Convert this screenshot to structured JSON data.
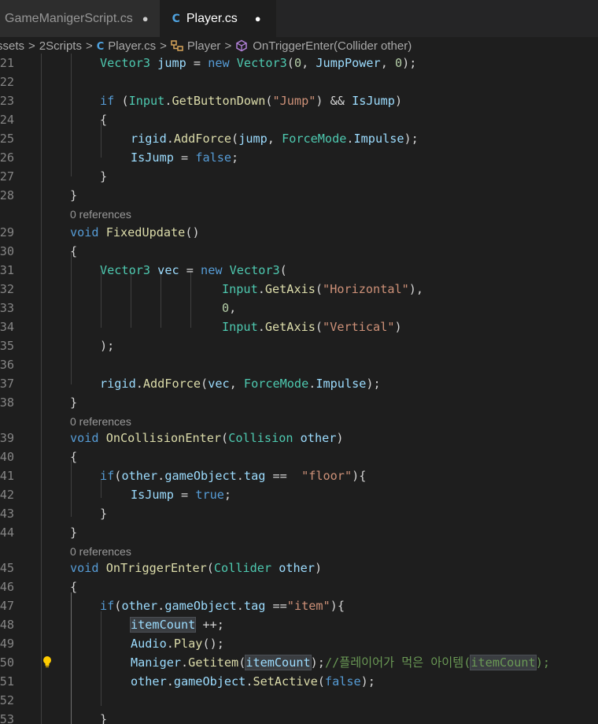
{
  "tabs": [
    {
      "label": "GameManigerScript.cs",
      "dirty": "●"
    },
    {
      "label": "Player.cs",
      "dirty": "●"
    }
  ],
  "icons": {
    "cs_file": "C#",
    "cs_glyph": "C",
    "class": "class-icon",
    "method": "method-icon",
    "lightbulb": "lightbulb-icon"
  },
  "breadcrumb": {
    "items": [
      "ssets",
      "2Scripts",
      "Player.cs",
      "Player",
      "OnTriggerEnter(Collider other)"
    ],
    "separator": ">"
  },
  "codelens": {
    "text": "0 references"
  },
  "line_numbers": [
    "21",
    "22",
    "23",
    "24",
    "25",
    "26",
    "27",
    "28",
    "29",
    "30",
    "31",
    "32",
    "33",
    "34",
    "35",
    "36",
    "37",
    "38",
    "39",
    "40",
    "41",
    "42",
    "43",
    "44",
    "45",
    "46",
    "47",
    "48",
    "49",
    "50",
    "51",
    "52",
    "53"
  ],
  "colors": {
    "background": "#1e1e1e",
    "keyword": "#569cd6",
    "type": "#4ec9b0",
    "function": "#dcdcaa",
    "variable": "#9cdcfe",
    "string": "#ce9178",
    "number": "#b5cea8",
    "comment": "#6a9955",
    "line_number": "#858585"
  },
  "code": {
    "l21": [
      "Vector3",
      " ",
      "jump",
      " = ",
      "new",
      " ",
      "Vector3",
      "(",
      "0",
      ", ",
      "JumpPower",
      ", ",
      "0",
      ");"
    ],
    "l23": [
      "if",
      " (",
      "Input",
      ".",
      "GetButtonDown",
      "(",
      "\"Jump\"",
      ") && ",
      "IsJump",
      ")"
    ],
    "l24": [
      "{"
    ],
    "l25": [
      "rigid",
      ".",
      "AddForce",
      "(",
      "jump",
      ", ",
      "ForceMode",
      ".",
      "Impulse",
      ");"
    ],
    "l26": [
      "IsJump",
      " = ",
      "false",
      ";"
    ],
    "l27": [
      "}"
    ],
    "l28": [
      "}"
    ],
    "l29": [
      "void",
      " ",
      "FixedUpdate",
      "()"
    ],
    "l30": [
      "{"
    ],
    "l31": [
      "Vector3",
      " ",
      "vec",
      " = ",
      "new",
      " ",
      "Vector3",
      "("
    ],
    "l32": [
      "Input",
      ".",
      "GetAxis",
      "(",
      "\"Horizontal\"",
      "),"
    ],
    "l33": [
      "0",
      ","
    ],
    "l34": [
      "Input",
      ".",
      "GetAxis",
      "(",
      "\"Vertical\"",
      ")"
    ],
    "l35": [
      ");"
    ],
    "l37": [
      "rigid",
      ".",
      "AddForce",
      "(",
      "vec",
      ", ",
      "ForceMode",
      ".",
      "Impulse",
      ");"
    ],
    "l38": [
      "}"
    ],
    "l39": [
      "void",
      " ",
      "OnCollisionEnter",
      "(",
      "Collision",
      " ",
      "other",
      ")"
    ],
    "l40": [
      "{"
    ],
    "l41": [
      "if",
      "(",
      "other",
      ".",
      "gameObject",
      ".",
      "tag",
      " ==  ",
      "\"floor\"",
      "){"
    ],
    "l42": [
      "IsJump",
      " = ",
      "true",
      ";"
    ],
    "l43": [
      "}"
    ],
    "l44": [
      "}"
    ],
    "l45": [
      "void",
      " ",
      "OnTriggerEnter",
      "(",
      "Collider",
      " ",
      "other",
      ")"
    ],
    "l46": [
      "{"
    ],
    "l47": [
      "if",
      "(",
      "other",
      ".",
      "gameObject",
      ".",
      "tag",
      " ==",
      "\"item\"",
      "){"
    ],
    "l48": [
      "itemCount",
      " ++;"
    ],
    "l49": [
      "Audio",
      ".",
      "Play",
      "();"
    ],
    "l50": [
      "Maniger",
      ".",
      "Getitem",
      "(",
      "itemCount",
      ");",
      "//플레이어가 먹은 아이템(",
      "itemCount",
      ");"
    ],
    "l51": [
      "other",
      ".",
      "gameObject",
      ".",
      "SetActive",
      "(",
      "false",
      ");"
    ],
    "l53": [
      "}"
    ]
  }
}
